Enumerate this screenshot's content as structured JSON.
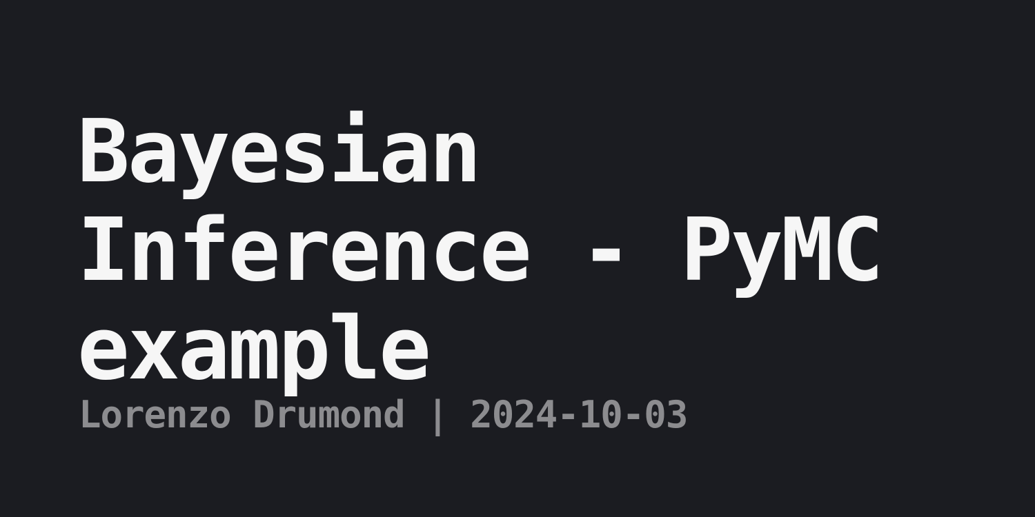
{
  "post": {
    "title_lines": [
      "Bayesian",
      "Inference - PyMC",
      "example"
    ],
    "author": "Lorenzo Drumond",
    "separator": " | ",
    "date": "2024-10-03"
  },
  "colors": {
    "background": "#1b1c21",
    "title": "#f6f6f6",
    "byline": "#8c8c8f"
  }
}
